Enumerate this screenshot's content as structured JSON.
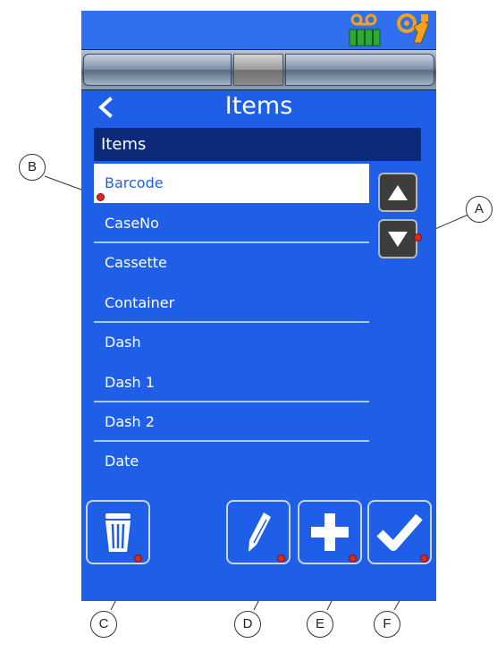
{
  "screen": {
    "title": "Items",
    "back_icon": "chevron-left-icon",
    "list_header": "Items",
    "items": [
      {
        "label": "Barcode",
        "selected": true
      },
      {
        "label": "CaseNo",
        "selected": false
      },
      {
        "label": "Cassette",
        "selected": false
      },
      {
        "label": "Container",
        "selected": false
      },
      {
        "label": "Dash",
        "selected": false
      },
      {
        "label": "Dash 1",
        "selected": false
      },
      {
        "label": "Dash 2",
        "selected": false
      },
      {
        "label": "Date",
        "selected": false
      }
    ],
    "scroll_up_icon": "arrow-up-icon",
    "scroll_down_icon": "arrow-down-icon",
    "buttons": {
      "delete": "trash-icon",
      "edit": "pencil-icon",
      "add": "plus-icon",
      "confirm": "checkmark-icon"
    }
  },
  "status_icons": [
    "tape-cassette-icon",
    "printhead-icon"
  ],
  "callouts": {
    "A": "A",
    "B": "B",
    "C": "C",
    "D": "D",
    "E": "E",
    "F": "F"
  },
  "colors": {
    "screen_bg": "#1f5fe8",
    "header_bg": "#0d2a7a",
    "selected_bg": "#ffffff",
    "divider": "#9fd0ff",
    "marker": "#e0281e"
  }
}
